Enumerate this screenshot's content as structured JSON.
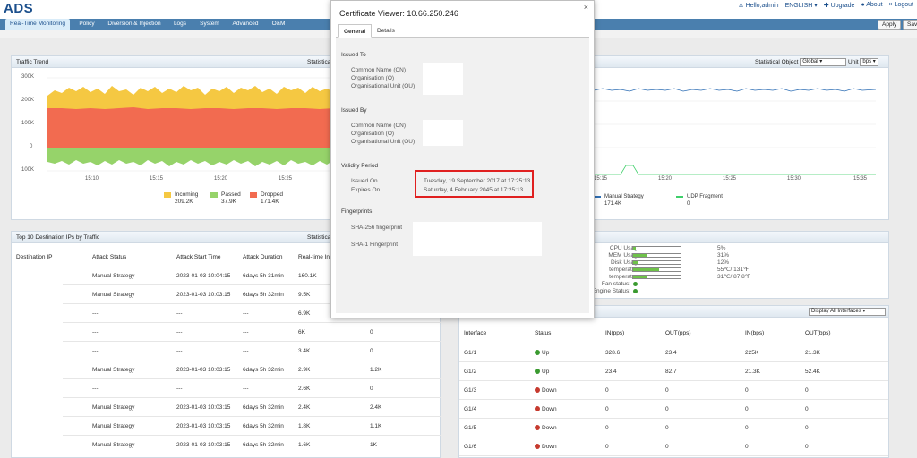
{
  "app": {
    "title": "ADS"
  },
  "top_links": {
    "user": "Hello,admin",
    "language": "ENGLISH",
    "upgrade": "Upgrade",
    "about": "About",
    "logout": "Logout"
  },
  "nav": [
    "Real-Time Monitoring",
    "Policy",
    "Diversion & Injection",
    "Logs",
    "System",
    "Advanced",
    "O&M"
  ],
  "toolbar": {
    "apply": "Apply",
    "save": "Save"
  },
  "traffic_trend": {
    "title": "Traffic Trend",
    "stat_label": "Statistical Object",
    "chart_data": {
      "type": "area",
      "y_ticks": [
        "300K",
        "200K",
        "100K",
        "0",
        "100K"
      ],
      "x_ticks": [
        "15:10",
        "15:15",
        "15:20",
        "15:25"
      ],
      "series": [
        {
          "name": "Incoming",
          "value": "209.2K",
          "color": "#f5c842"
        },
        {
          "name": "Passed",
          "value": "37.9K",
          "color": "#96d36a"
        },
        {
          "name": "Dropped",
          "value": "171.4K",
          "color": "#f26b50"
        }
      ]
    }
  },
  "right_trend": {
    "stat_label": "Statistical Object",
    "stat_value": "Global",
    "unit_label": "Unit",
    "unit_value": "bps",
    "x_ticks": [
      "15:15",
      "15:20",
      "15:25",
      "15:30",
      "15:35"
    ],
    "legend": [
      {
        "name": "Manual Strategy",
        "value": "171.4K",
        "color": "#2f6fb5"
      },
      {
        "name": "UDP Fragment",
        "value": "0",
        "color": "#3fcf6a"
      }
    ]
  },
  "top_ips": {
    "title": "Top 10 Destination IPs by Traffic",
    "stat_label": "Statistical",
    "columns": [
      "Destination IP",
      "Attack Status",
      "Attack Start Time",
      "Attack Duration",
      "Real-time Inc"
    ],
    "rows": [
      {
        "status": "Manual Strategy",
        "start": "2023-01-03 10:04:15",
        "duration": "6days 5h 31min",
        "incoming": "160.1K",
        "extra": ""
      },
      {
        "status": "Manual Strategy",
        "start": "2023-01-03 10:03:15",
        "duration": "6days 5h 32min",
        "incoming": "9.5K",
        "extra": ""
      },
      {
        "status": "---",
        "start": "---",
        "duration": "---",
        "incoming": "6.9K",
        "extra": ""
      },
      {
        "status": "---",
        "start": "---",
        "duration": "---",
        "incoming": "6K",
        "extra": "0"
      },
      {
        "status": "---",
        "start": "---",
        "duration": "---",
        "incoming": "3.4K",
        "extra": "0"
      },
      {
        "status": "Manual Strategy",
        "start": "2023-01-03 10:03:15",
        "duration": "6days 5h 32min",
        "incoming": "2.9K",
        "extra": "1.2K"
      },
      {
        "status": "---",
        "start": "---",
        "duration": "---",
        "incoming": "2.6K",
        "extra": "0"
      },
      {
        "status": "Manual Strategy",
        "start": "2023-01-03 10:03:15",
        "duration": "6days 5h 32min",
        "incoming": "2.4K",
        "extra": "2.4K"
      },
      {
        "status": "Manual Strategy",
        "start": "2023-01-03 10:03:15",
        "duration": "6days 5h 32min",
        "incoming": "1.8K",
        "extra": "1.1K"
      },
      {
        "status": "Manual Strategy",
        "start": "2023-01-03 10:03:15",
        "duration": "6days 5h 32min",
        "incoming": "1.6K",
        "extra": "1K"
      }
    ]
  },
  "system_status": {
    "rows": [
      {
        "label": "CPU Usage:",
        "value": "5%",
        "fill": 0.05
      },
      {
        "label": "MEM Usage:",
        "value": "31%",
        "fill": 0.31
      },
      {
        "label": "Disk Usage:",
        "value": "12%",
        "fill": 0.12
      },
      {
        "label": "temperature:",
        "value": "55℃/ 131℉",
        "fill": 0.55
      },
      {
        "label": "temperature:",
        "value": "31℃/ 87.8℉",
        "fill": 0.31
      }
    ],
    "fan": "Fan status:",
    "engine": "Engine Status:"
  },
  "interfaces": {
    "filter": "Display All Interfaces",
    "columns": [
      "Interface",
      "Status",
      "IN(pps)",
      "OUT(pps)",
      "IN(bps)",
      "OUT(bps)"
    ],
    "rows": [
      {
        "name": "G1/1",
        "status": "Up",
        "in_pps": "328.6",
        "out_pps": "23.4",
        "in_bps": "225K",
        "out_bps": "21.3K"
      },
      {
        "name": "G1/2",
        "status": "Up",
        "in_pps": "23.4",
        "out_pps": "82.7",
        "in_bps": "21.3K",
        "out_bps": "52.4K"
      },
      {
        "name": "G1/3",
        "status": "Down",
        "in_pps": "0",
        "out_pps": "0",
        "in_bps": "0",
        "out_bps": "0"
      },
      {
        "name": "G1/4",
        "status": "Down",
        "in_pps": "0",
        "out_pps": "0",
        "in_bps": "0",
        "out_bps": "0"
      },
      {
        "name": "G1/5",
        "status": "Down",
        "in_pps": "0",
        "out_pps": "0",
        "in_bps": "0",
        "out_bps": "0"
      },
      {
        "name": "G1/6",
        "status": "Down",
        "in_pps": "0",
        "out_pps": "0",
        "in_bps": "0",
        "out_bps": "0"
      }
    ]
  },
  "cert": {
    "title": "Certificate Viewer: 10.66.250.246",
    "close": "×",
    "tabs": [
      "General",
      "Details"
    ],
    "issued_to": "Issued To",
    "issued_by": "Issued By",
    "fields": [
      "Common Name (CN)",
      "Organisation (O)",
      "Organisational Unit (OU)"
    ],
    "validity": "Validity Period",
    "issued_on_label": "Issued On",
    "expires_on_label": "Expires On",
    "issued_on": "Tuesday, 19 September 2017 at 17:25:13",
    "expires_on": "Saturday, 4 February 2045 at 17:25:13",
    "fingerprints": "Fingerprints",
    "sha256": "SHA-256 fingerprint",
    "sha1": "SHA-1 Fingerprint"
  }
}
